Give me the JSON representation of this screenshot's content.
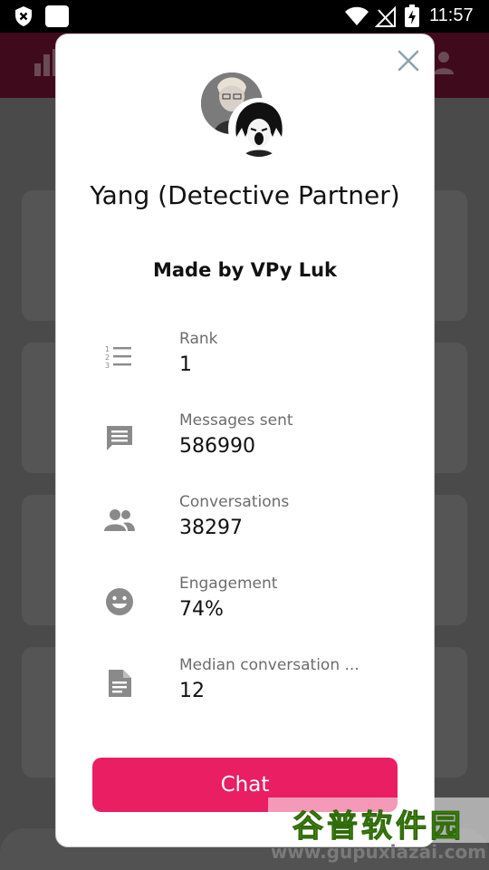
{
  "status_bar": {
    "time": "11:57"
  },
  "character": {
    "name": "Yang (Detective Partner)",
    "creator": "Made by VPy Luk"
  },
  "stats": [
    {
      "label": "Rank",
      "value": "1",
      "icon": "numbered-list-icon"
    },
    {
      "label": "Messages sent",
      "value": "586990",
      "icon": "message-icon"
    },
    {
      "label": "Conversations",
      "value": "38297",
      "icon": "people-icon"
    },
    {
      "label": "Engagement",
      "value": "74%",
      "icon": "smiley-icon"
    },
    {
      "label": "Median conversation ...",
      "value": "12",
      "icon": "document-icon"
    }
  ],
  "actions": {
    "chat_label": "Chat"
  },
  "watermark": {
    "title": "谷普软件园",
    "url": "www.gupuxiazai.com"
  },
  "colors": {
    "accent": "#e91e63",
    "icon_gray": "#8a8a8a",
    "header_bg": "#3f0a1c"
  }
}
